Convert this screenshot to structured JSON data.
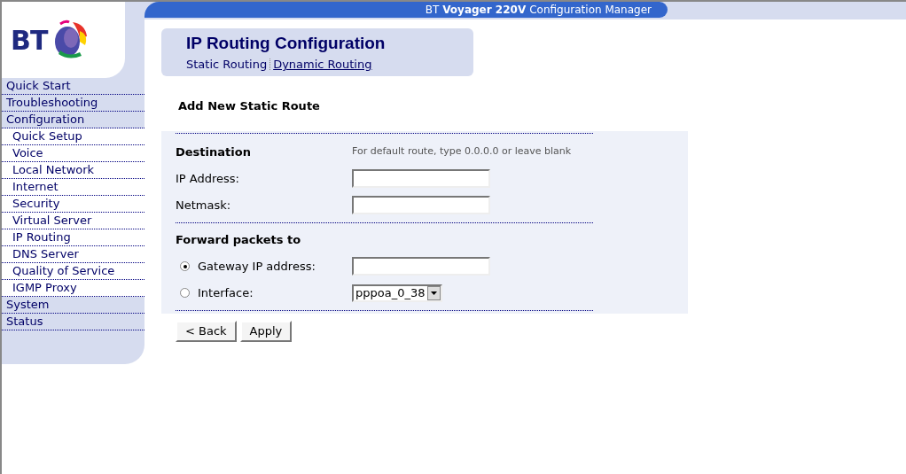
{
  "header": {
    "brand": "BT",
    "title_parts": [
      "BT",
      "Voyager 220V",
      "Configuration Manager"
    ]
  },
  "sidebar": {
    "items": [
      {
        "label": "Quick Start",
        "kind": "top"
      },
      {
        "label": "Troubleshooting",
        "kind": "top"
      },
      {
        "label": "Configuration",
        "kind": "top"
      },
      {
        "label": "Quick Setup",
        "kind": "sub"
      },
      {
        "label": "Voice",
        "kind": "sub"
      },
      {
        "label": "Local Network",
        "kind": "sub"
      },
      {
        "label": "Internet",
        "kind": "sub"
      },
      {
        "label": "Security",
        "kind": "sub"
      },
      {
        "label": "Virtual Server",
        "kind": "sub"
      },
      {
        "label": "IP Routing",
        "kind": "sub"
      },
      {
        "label": "DNS Server",
        "kind": "sub"
      },
      {
        "label": "Quality of Service",
        "kind": "sub"
      },
      {
        "label": "IGMP Proxy",
        "kind": "sub"
      },
      {
        "label": "System",
        "kind": "top"
      },
      {
        "label": "Status",
        "kind": "top"
      }
    ]
  },
  "page": {
    "title": "IP Routing Configuration",
    "tabs": [
      {
        "label": "Static Routing",
        "selected": true
      },
      {
        "label": "Dynamic Routing",
        "selected": false
      }
    ],
    "section_title": "Add New Static Route",
    "destination": {
      "heading": "Destination",
      "hint": "For default route, type 0.0.0.0 or leave blank",
      "fields": [
        {
          "label": "IP Address:"
        },
        {
          "label": "Netmask:"
        }
      ]
    },
    "forward": {
      "heading": "Forward packets to",
      "options": [
        {
          "label": "Gateway IP address:",
          "checked": true,
          "kind": "text"
        },
        {
          "label": "Interface:",
          "checked": false,
          "kind": "select",
          "value": "pppoa_0_38"
        }
      ]
    },
    "buttons": [
      "< Back",
      "Apply"
    ]
  }
}
